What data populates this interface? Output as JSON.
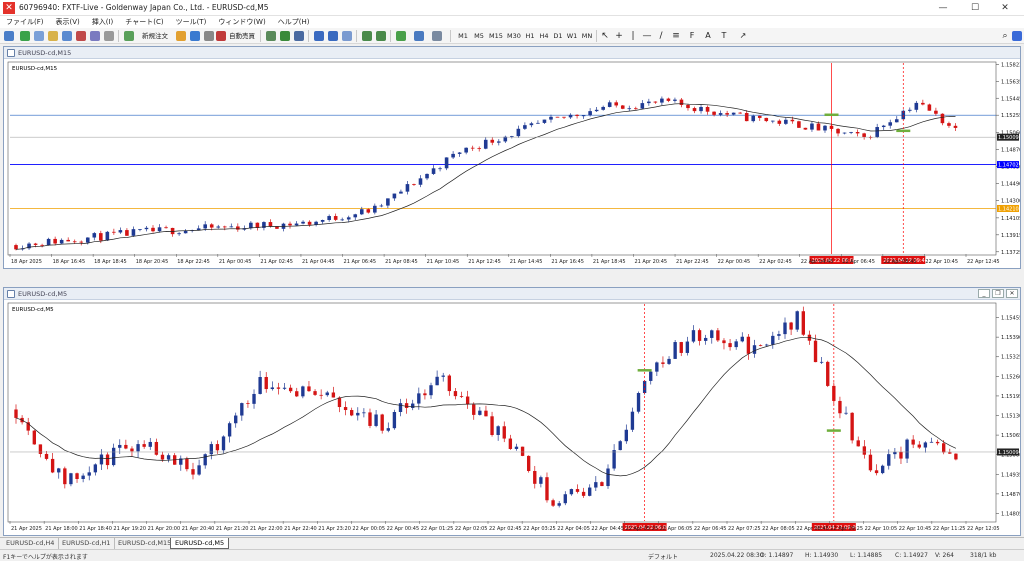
{
  "window": {
    "title": "60796940: FXTF-Live - Goldenway Japan Co., Ltd. - EURUSD-cd,M5",
    "minimize": "—",
    "maximize": "☐",
    "close": "✕"
  },
  "menu": [
    "ファイル(F)",
    "表示(V)",
    "挿入(I)",
    "チャート(C)",
    "ツール(T)",
    "ウィンドウ(W)",
    "ヘルプ(H)"
  ],
  "toolbar": {
    "new_order": "新規注文",
    "auto_trade": "自動売買",
    "timeframes": [
      "M1",
      "M5",
      "M15",
      "M30",
      "H1",
      "H4",
      "D1",
      "W1",
      "MN"
    ]
  },
  "colors": {
    "bull": "#1f3a93",
    "bear": "#d41414",
    "ma": "#222222",
    "blue_line": "#0000ff",
    "orange_line": "#f0a000",
    "red_vline": "#ff0000",
    "green_marker": "#6fae3c",
    "cap_bg": "#e9eef5"
  },
  "chart_top": {
    "title": "EURUSD-cd,M15",
    "label": "EURUSD-cd,M15",
    "y_ticks": [
      "1.15823",
      "1.15635",
      "1.15445",
      "1.15255",
      "1.15060",
      "1.14870",
      "1.14680",
      "1.14490",
      "1.14300",
      "1.14105",
      "1.13915",
      "1.13725"
    ],
    "price_labels": {
      "current": "1.15009",
      "blue": "1.14702",
      "orange": "1.14210"
    },
    "x_labels": [
      "18 Apr 2025",
      "18 Apr 16:45",
      "18 Apr 18:45",
      "18 Apr 20:45",
      "18 Apr 22:45",
      "21 Apr 00:45",
      "21 Apr 02:45",
      "21 Apr 04:45",
      "21 Apr 06:45",
      "21 Apr 08:45",
      "21 Apr 10:45",
      "21 Apr 12:45",
      "21 Apr 14:45",
      "21 Apr 16:45",
      "21 Apr 18:45",
      "21 Apr 20:45",
      "21 Apr 22:45",
      "22 Apr 00:45",
      "22 Apr 02:45",
      "22 Apr 04:45",
      "22 Apr 06:45",
      "22 Apr 08:45",
      "22 Apr 10:45",
      "22 Apr 12:45"
    ],
    "vline_labels": [
      "2025.04.22 06:00",
      "2025.04.22 09:40"
    ]
  },
  "chart_bottom": {
    "title": "EURUSD-cd,M5",
    "label": "EURUSD-cd,M5",
    "y_ticks": [
      "1.15455",
      "1.15390",
      "1.15325",
      "1.15260",
      "1.15195",
      "1.15130",
      "1.15065",
      "1.15000",
      "1.14935",
      "1.14870",
      "1.14805"
    ],
    "price_labels": {
      "current": "1.15009"
    },
    "x_labels": [
      "21 Apr 2025",
      "21 Apr 18:00",
      "21 Apr 18:40",
      "21 Apr 19:20",
      "21 Apr 20:00",
      "21 Apr 20:40",
      "21 Apr 21:20",
      "21 Apr 22:00",
      "21 Apr 22:40",
      "21 Apr 23:20",
      "22 Apr 00:05",
      "22 Apr 00:45",
      "22 Apr 01:25",
      "22 Apr 02:05",
      "22 Apr 02:45",
      "22 Apr 03:25",
      "22 Apr 04:05",
      "22 Apr 04:45",
      "22 Apr 05:25",
      "22 Apr 06:05",
      "22 Apr 06:45",
      "22 Apr 07:25",
      "22 Apr 08:05",
      "22 Apr 08:45",
      "22 Apr 09:25",
      "22 Apr 10:05",
      "22 Apr 10:45",
      "22 Apr 11:25",
      "22 Apr 12:05"
    ],
    "vline_labels": [
      "2025.04.22 06:00",
      "2025.04.22 09:40"
    ]
  },
  "tabs": [
    "EURUSD-cd,H4",
    "EURUSD-cd,H1",
    "EURUSD-cd,M15",
    "EURUSD-cd,M5"
  ],
  "status": {
    "help": "F1キーでヘルプが表示されます",
    "profile": "デフォルト",
    "time": "2025.04.22 08:30",
    "open": "O: 1.14897",
    "high": "H: 1.14930",
    "low": "L: 1.14885",
    "close": "C: 1.14927",
    "volume": "V: 264",
    "traffic": "318/1 kb"
  }
}
